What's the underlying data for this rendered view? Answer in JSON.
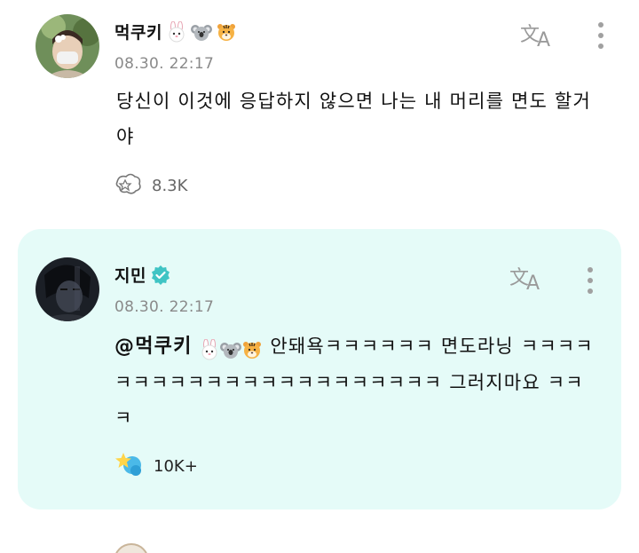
{
  "post": {
    "author": "먹쿠키",
    "time": "08.30. 22:17",
    "text": "당신이 이것에 응답하지 않으면 나는 내 머리를 면도 할거야",
    "reaction_count": "8.3K"
  },
  "reply": {
    "author": "지민",
    "time": "08.30. 22:17",
    "mention": "@먹쿠키",
    "text": "안돼욕ㅋㅋㅋㅋㅋㅋ 면도라닝 ㅋㅋㅋㅋㅋㅋㅋㅋㅋㅋㅋㅋㅋㅋㅋㅋㅋㅋㅋㅋㅋㅋ 그러지마요 ㅋㅋㅋ",
    "reaction_count": "10K+"
  },
  "icons": {
    "translate": "translate-icon",
    "more": "more-vertical-icon",
    "reaction_outline": "reaction-outline-icon",
    "reaction_filled": "reaction-filled-icon",
    "verified": "verified-badge-icon",
    "rabbit": "rabbit-emoji",
    "koala": "koala-emoji",
    "tiger": "tiger-emoji"
  },
  "colors": {
    "reply_background": "#e5fbf8",
    "verified": "#3fc4c4",
    "timestamp": "#8a8a8a"
  }
}
